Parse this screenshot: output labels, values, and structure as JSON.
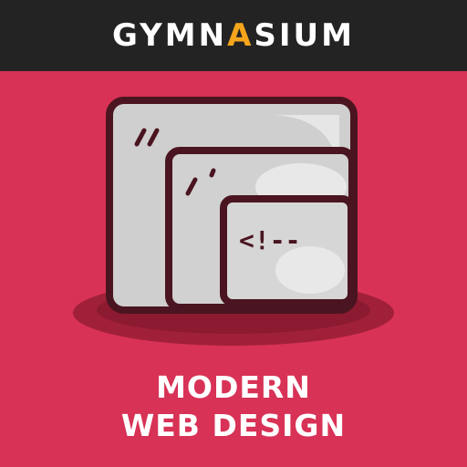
{
  "brand": {
    "name_prefix": "GYMN",
    "name_accent": "A",
    "name_suffix": "SIUM",
    "accent_color": "#f4a51c",
    "header_color": "#232323"
  },
  "illustration": {
    "icon": "nested-browser-windows-icon",
    "code_text": "<!--"
  },
  "course": {
    "title_line1": "MODERN",
    "title_line2": "WEB DESIGN"
  },
  "colors": {
    "background": "#d83256",
    "window_outline": "#4a1520",
    "window_fill": "#d4d4d4"
  }
}
